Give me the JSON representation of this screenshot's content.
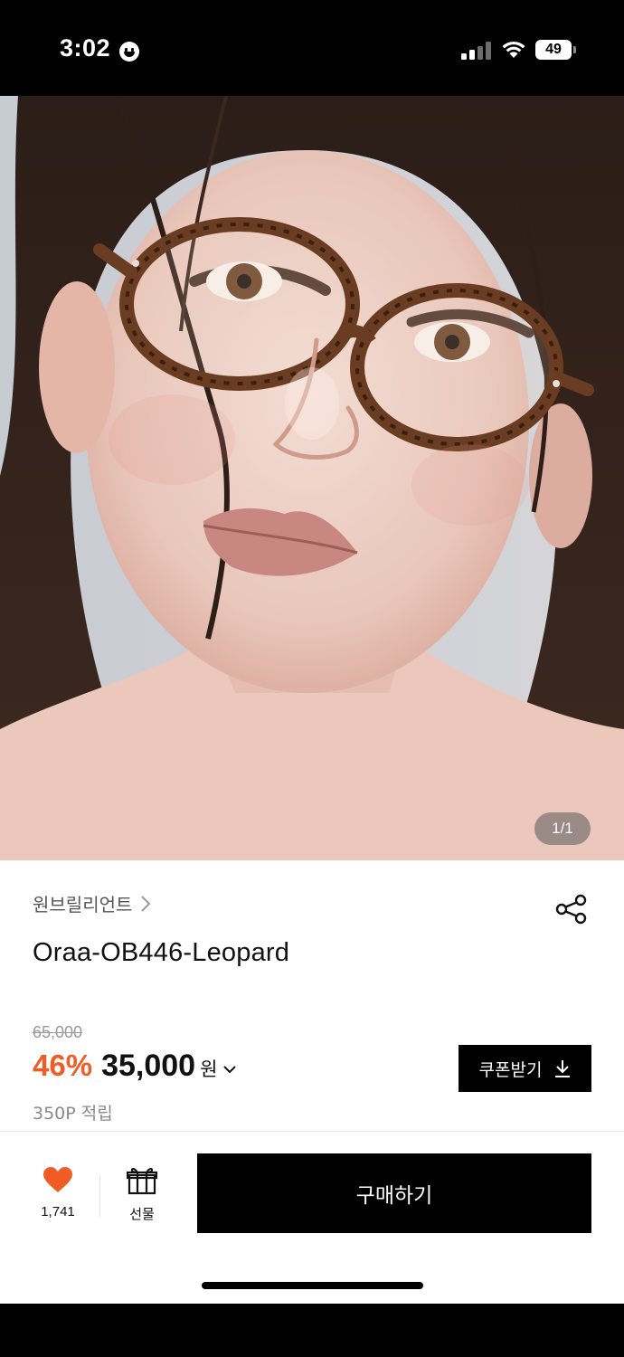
{
  "status_bar": {
    "time": "3:02",
    "battery": "49"
  },
  "hero": {
    "image_alt": "model wearing leopard round eyeglasses",
    "pager": "1/1"
  },
  "product": {
    "brand": "원브릴리언트",
    "name": "Oraa-OB446-Leopard",
    "original_price": "65,000",
    "discount": "46%",
    "price": "35,000",
    "currency": "원",
    "coupon_label": "쿠폰받기",
    "points": "350P 적립"
  },
  "bottom_bar": {
    "like_count": "1,741",
    "gift_label": "선물",
    "buy_label": "구매하기"
  },
  "colors": {
    "accent": "#f15c25",
    "heart": "#f15c25",
    "button": "#000000"
  },
  "icons": [
    "smiley-icon",
    "signal-icon",
    "wifi-icon",
    "battery-icon",
    "chevron-right-icon",
    "share-icon",
    "chevron-down-icon",
    "download-icon",
    "heart-icon",
    "gift-icon"
  ]
}
